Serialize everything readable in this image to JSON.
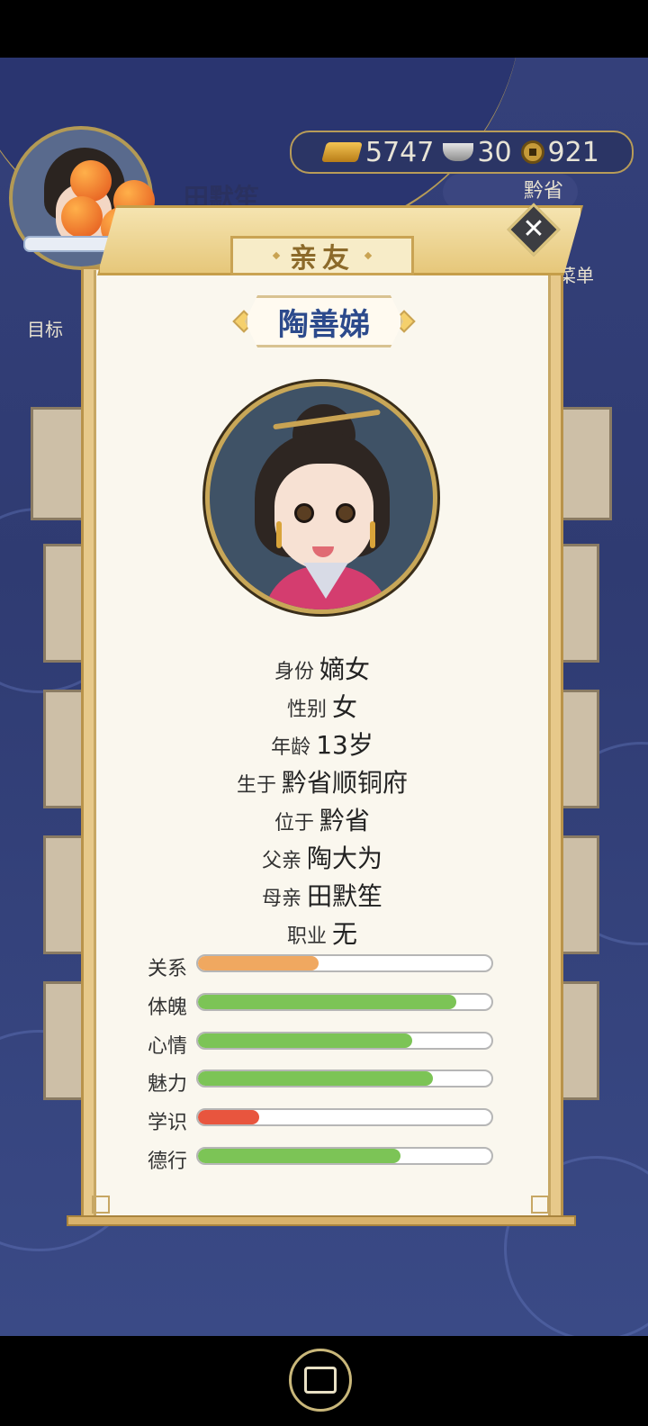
{
  "hud": {
    "gold": "5747",
    "silver": "30",
    "coins": "921",
    "player_name": "田默笙",
    "location": "黔省",
    "menu_label": "菜单",
    "target_label": "目标"
  },
  "dialog": {
    "title": "亲友",
    "person_name": "陶善娣",
    "info": [
      {
        "label": "身份",
        "value": "嫡女"
      },
      {
        "label": "性别",
        "value": "女"
      },
      {
        "label": "年龄",
        "value": "13岁"
      },
      {
        "label": "生于",
        "value": "黔省顺铜府"
      },
      {
        "label": "位于",
        "value": "黔省"
      },
      {
        "label": "父亲",
        "value": "陶大为"
      },
      {
        "label": "母亲",
        "value": "田默笙"
      },
      {
        "label": "职业",
        "value": "无"
      }
    ],
    "stats": [
      {
        "label": "关系",
        "value": 0.41,
        "color": "#f0a860"
      },
      {
        "label": "体魄",
        "value": 0.88,
        "color": "#7cc456"
      },
      {
        "label": "心情",
        "value": 0.73,
        "color": "#7cc456"
      },
      {
        "label": "魅力",
        "value": 0.8,
        "color": "#7cc456"
      },
      {
        "label": "学识",
        "value": 0.21,
        "color": "#e8553e"
      },
      {
        "label": "德行",
        "value": 0.69,
        "color": "#7cc456"
      }
    ]
  },
  "icons": {
    "close": "close-icon",
    "share": "share-icon"
  }
}
